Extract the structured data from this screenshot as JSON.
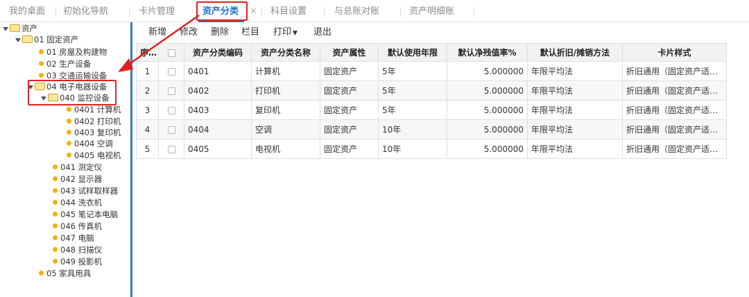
{
  "tabs": [
    {
      "label": "我的桌面",
      "active": false
    },
    {
      "label": "初始化导航",
      "active": false
    },
    {
      "label": "卡片管理",
      "active": false
    },
    {
      "label": "资产分类",
      "active": true
    },
    {
      "label": "科目设置",
      "active": false
    },
    {
      "label": "与总账对账",
      "active": false
    },
    {
      "label": "资产明细账",
      "active": false
    }
  ],
  "tree": {
    "root": "资产",
    "fixed_assets": "01 固定资产",
    "n02_01": "01 房屋及构建物",
    "n02_02": "02 生产设备",
    "n02_03": "03 交通运输设备",
    "n02_04": "04 电子电器设备",
    "n040": "040 监控设备",
    "n0401": "0401 计算机",
    "n0402": "0402 打印机",
    "n0403": "0403 复印机",
    "n0404": "0404 空调",
    "n0405": "0405 电视机",
    "n041": "041 测定仪",
    "n042": "042 显示器",
    "n043": "043 试样取样器",
    "n044": "044 洗衣机",
    "n045": "045 笔记本电脑",
    "n046": "046 传真机",
    "n047": "047 电脑",
    "n048": "048 扫描仪",
    "n049": "049 投影机",
    "n05": "05 家具用具"
  },
  "toolbar": {
    "add": "新增",
    "edit": "修改",
    "delete": "删除",
    "columns": "栏目",
    "print": "打印",
    "exit": "退出"
  },
  "table": {
    "headers": [
      "序号",
      "",
      "资产分类编码",
      "资产分类名称",
      "资产属性",
      "默认使用年限",
      "默认净残值率%",
      "默认折旧/摊销方法",
      "卡片样式"
    ],
    "rows": [
      [
        "1",
        "0401",
        "计算机",
        "固定资产",
        "5年",
        "5.000000",
        "年限平均法",
        "折旧通用（固定资产适…"
      ],
      [
        "2",
        "0402",
        "打印机",
        "固定资产",
        "5年",
        "5.000000",
        "年限平均法",
        "折旧通用（固定资产适…"
      ],
      [
        "3",
        "0403",
        "复印机",
        "固定资产",
        "5年",
        "5.000000",
        "年限平均法",
        "折旧通用（固定资产适…"
      ],
      [
        "4",
        "0404",
        "空调",
        "固定资产",
        "10年",
        "5.000000",
        "年限平均法",
        "折旧通用（固定资产适…"
      ],
      [
        "5",
        "0405",
        "电视机",
        "固定资产",
        "10年",
        "5.000000",
        "年限平均法",
        "折旧通用（固定资产适…"
      ]
    ]
  },
  "colors": {
    "accent": "#1f6fd6",
    "highlight": "#e02020",
    "folder": "#f6d34f",
    "leaf": "#f0b400"
  }
}
